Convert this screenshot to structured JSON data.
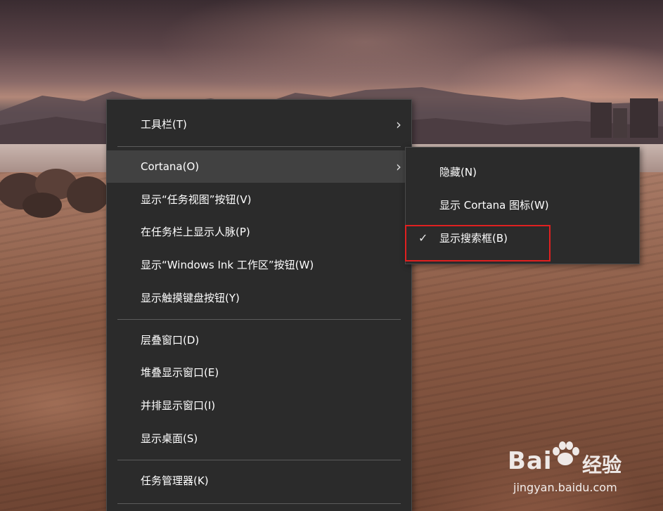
{
  "context_menu": {
    "items": [
      {
        "label": "工具栏(T)",
        "has_submenu": true
      },
      {
        "label": "Cortana(O)",
        "has_submenu": true,
        "state": "hover"
      },
      {
        "label": "显示“任务视图”按钮(V)"
      },
      {
        "label": "在任务栏上显示人脉(P)"
      },
      {
        "label": "显示“Windows Ink 工作区”按钮(W)"
      },
      {
        "label": "显示触摸键盘按钮(Y)"
      },
      {
        "label": "层叠窗口(D)"
      },
      {
        "label": "堆叠显示窗口(E)"
      },
      {
        "label": "并排显示窗口(I)"
      },
      {
        "label": "显示桌面(S)"
      },
      {
        "label": "任务管理器(K)"
      }
    ]
  },
  "cortana_submenu": {
    "items": [
      {
        "label": "隐藏(N)",
        "checked": false
      },
      {
        "label": "显示 Cortana 图标(W)",
        "checked": false
      },
      {
        "label": "显示搜索框(B)",
        "checked": true
      }
    ]
  },
  "icons": {
    "submenu_arrow": "chevron-right-icon",
    "checkmark": "checkmark-icon"
  },
  "colors": {
    "menu_background": "#2b2b2b",
    "hover_background": "#414141",
    "highlight_border": "#e02020"
  },
  "watermark": {
    "logo": "Bai",
    "brand_cn": "经验",
    "url": "jingyan.baidu.com"
  }
}
